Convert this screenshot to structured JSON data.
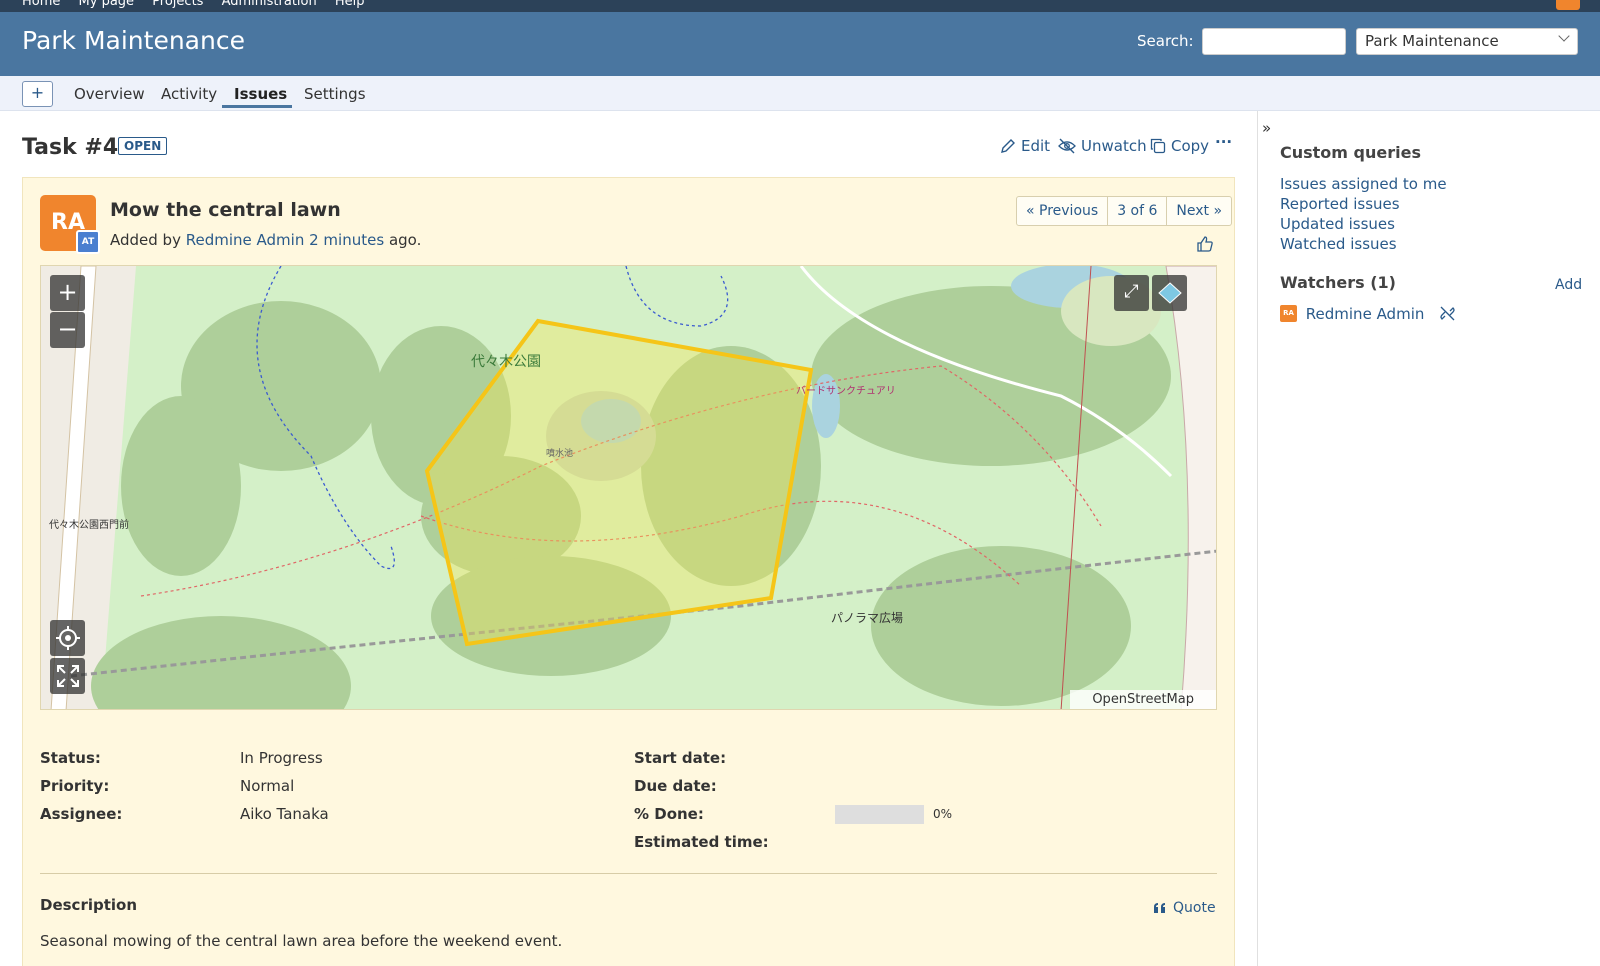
{
  "top_menu": {
    "items": [
      "Home",
      "My page",
      "Projects",
      "Administration",
      "Help"
    ]
  },
  "header": {
    "title": "Park Maintenance",
    "search_label": "Search:",
    "search_value": "",
    "project_select": "Park Maintenance"
  },
  "main_menu": {
    "new_label": "+",
    "tabs": [
      {
        "label": "Overview"
      },
      {
        "label": "Activity"
      },
      {
        "label": "Issues",
        "active": true
      },
      {
        "label": "Settings"
      }
    ]
  },
  "issue": {
    "heading": "Task #4",
    "status_badge": "OPEN",
    "actions": {
      "edit": "Edit",
      "unwatch": "Unwatch",
      "copy": "Copy",
      "more": "···"
    },
    "avatar_initials": "RA",
    "avatar_badge": "AT",
    "subject": "Mow the central lawn",
    "added_by_prefix": "Added by",
    "author": "Redmine Admin",
    "time_ago": "2 minutes",
    "ago_suffix": "ago.",
    "pager": {
      "previous": "« Previous",
      "position": "3 of 6",
      "next": "Next »"
    },
    "map": {
      "attribution": "OpenStreetMap",
      "zoom_in": "+",
      "zoom_out": "−",
      "labels": {
        "park": "代々木公園",
        "plaza": "パノラマ広場",
        "bird": "バードサンクチュアリ",
        "pond": "噴水池",
        "station": "代々木公園西門前"
      }
    },
    "attributes": {
      "status_label": "Status:",
      "status_value": "In Progress",
      "priority_label": "Priority:",
      "priority_value": "Normal",
      "assignee_label": "Assignee:",
      "assignee_value": "Aiko Tanaka",
      "start_label": "Start date:",
      "start_value": "",
      "due_label": "Due date:",
      "due_value": "",
      "done_label": "% Done:",
      "done_value": "0%",
      "done_fraction": 0,
      "estimated_label": "Estimated time:",
      "estimated_value": ""
    },
    "description_title": "Description",
    "quote_label": "Quote",
    "description_text": "Seasonal mowing of the central lawn area before the weekend event."
  },
  "sidebar": {
    "custom_queries_title": "Custom queries",
    "queries": [
      "Issues assigned to me",
      "Reported issues",
      "Updated issues",
      "Watched issues"
    ],
    "watchers_title": "Watchers (1)",
    "add_label": "Add",
    "watcher_initials": "RA",
    "watcher_name": "Redmine Admin"
  },
  "colors": {
    "header": "#4a76a0",
    "top_menu": "#2c4259",
    "issue_bg": "#fff8df",
    "accent": "#f0852d",
    "link": "#2a5a8a",
    "polygon": "#f5c518"
  }
}
